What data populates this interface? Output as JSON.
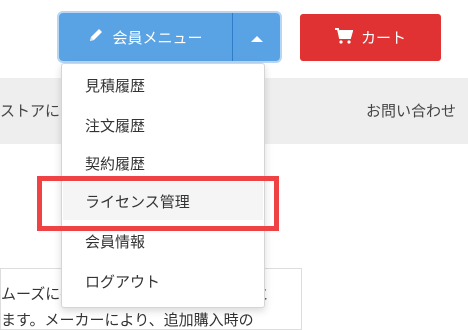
{
  "header": {
    "member_menu_label": "会員メニュー",
    "cart_label": "カート"
  },
  "nav": {
    "left_text": "ストアにつ",
    "right_text": "お問い合わせ"
  },
  "dropdown": {
    "items": [
      {
        "label": "見積履歴"
      },
      {
        "label": "注文履歴"
      },
      {
        "label": "契約履歴"
      },
      {
        "label": "ライセンス管理"
      },
      {
        "label": "会員情報"
      },
      {
        "label": "ログアウト"
      }
    ]
  },
  "content": {
    "line1": "ムーズに行えます。また、メーカーごと",
    "line2": "ます。メーカーにより、追加購入時の"
  },
  "colors": {
    "member_button": "#59a2e4",
    "cart_button": "#e03233",
    "highlight_border": "#ef4245"
  }
}
